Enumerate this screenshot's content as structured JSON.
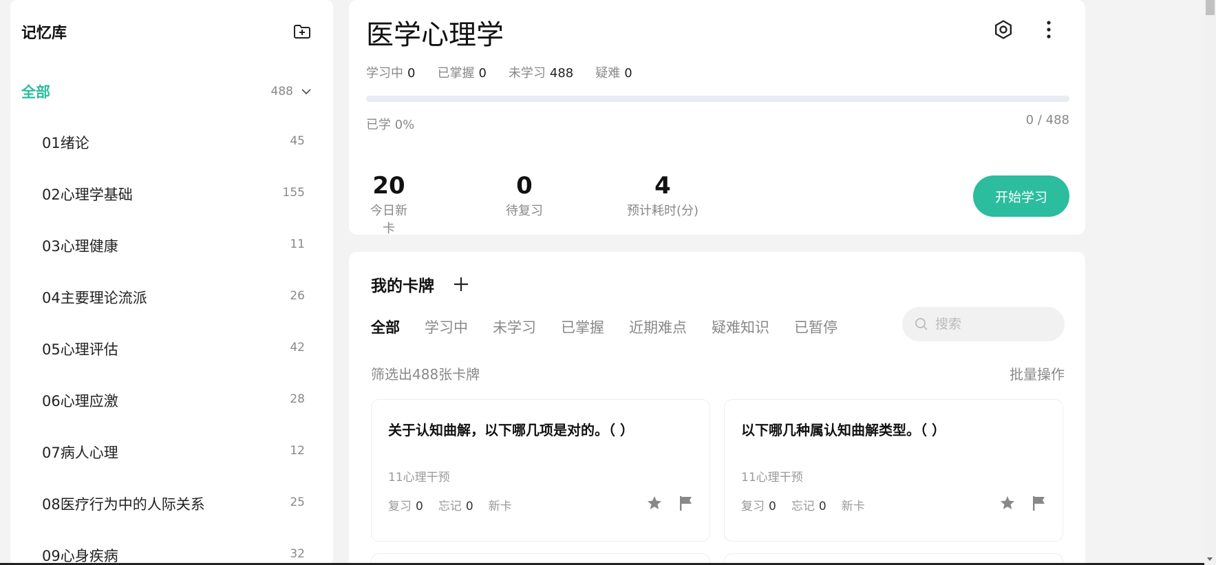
{
  "sidebar": {
    "title": "记忆库",
    "all": {
      "label": "全部",
      "count": "488"
    },
    "items": [
      {
        "name": "01绪论",
        "count": "45"
      },
      {
        "name": "02心理学基础",
        "count": "155"
      },
      {
        "name": "03心理健康",
        "count": "11"
      },
      {
        "name": "04主要理论流派",
        "count": "26"
      },
      {
        "name": "05心理评估",
        "count": "42"
      },
      {
        "name": "06心理应激",
        "count": "28"
      },
      {
        "name": "07病人心理",
        "count": "12"
      },
      {
        "name": "08医疗行为中的人际关系",
        "count": "25"
      },
      {
        "name": "09心身疾病",
        "count": "32"
      }
    ]
  },
  "header": {
    "title": "医学心理学",
    "stats": [
      {
        "label": "学习中",
        "value": "0"
      },
      {
        "label": "已掌握",
        "value": "0"
      },
      {
        "label": "未学习",
        "value": "488"
      },
      {
        "label": "疑难",
        "value": "0"
      }
    ],
    "progress_fraction": 0,
    "learned_pct": "已学 0%",
    "learned_frac": "0 / 488",
    "big_stats": [
      {
        "value": "20",
        "label": "今日新卡"
      },
      {
        "value": "0",
        "label": "待复习"
      },
      {
        "value": "4",
        "label": "预计耗时(分)"
      }
    ],
    "start_label": "开始学习"
  },
  "cards_panel": {
    "title": "我的卡牌",
    "tabs": [
      "全部",
      "学习中",
      "未学习",
      "已掌握",
      "近期难点",
      "疑难知识",
      "已暂停"
    ],
    "search_placeholder": "搜索",
    "filter_text": "筛选出488张卡牌",
    "batch_label": "批量操作",
    "cards": [
      {
        "question": "关于认知曲解，以下哪几项是对的。（ ）",
        "deck": "11心理干预",
        "review_label": "复习",
        "review": "0",
        "forget_label": "忘记",
        "forget": "0",
        "status": "新卡"
      },
      {
        "question": "以下哪几种属认知曲解类型。（ ）",
        "deck": "11心理干预",
        "review_label": "复习",
        "review": "0",
        "forget_label": "忘记",
        "forget": "0",
        "status": "新卡"
      }
    ]
  },
  "colors": {
    "accent": "#2bbd9e",
    "muted": "#888888",
    "track": "#e8ecf3"
  }
}
